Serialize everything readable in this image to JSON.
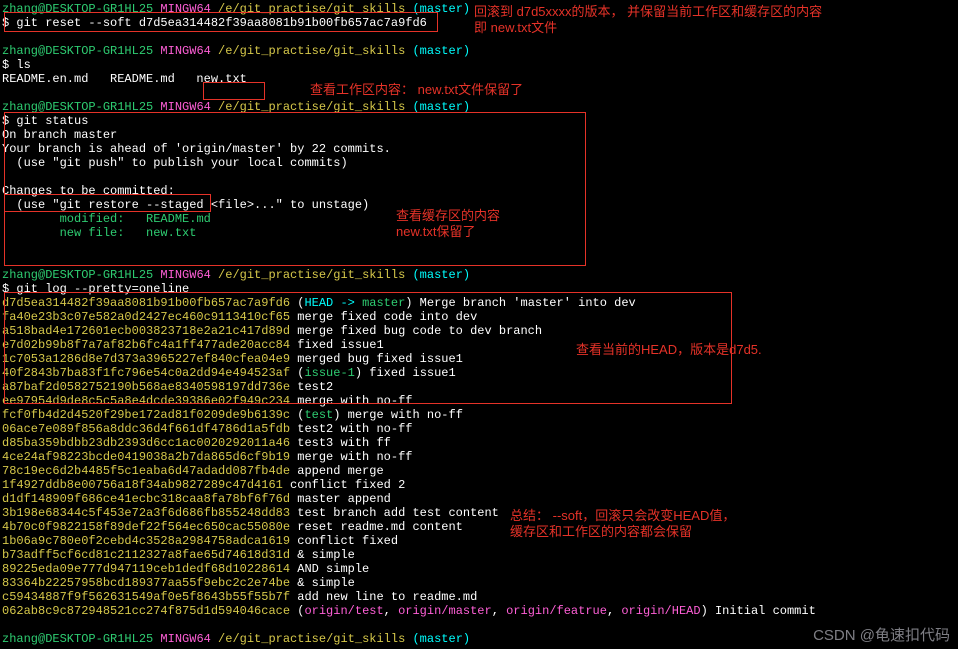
{
  "prompt": {
    "user": "zhang@DESKTOP-GR1HL25",
    "shell": " MINGW64 ",
    "path": "/e/git_practise/git_skills",
    "branch": " (master)"
  },
  "cmds": {
    "reset": "git reset --soft d7d5ea314482f39aa8081b91b00fb657ac7a9fd6",
    "ls": "ls",
    "status": "git status",
    "log": "git log --pretty=oneline"
  },
  "ls_out": "README.en.md   README.md   new.txt",
  "status": {
    "l1": "On branch master",
    "l2": "Your branch is ahead of 'origin/master' by 22 commits.",
    "l3": "  (use \"git push\" to publish your local commits)",
    "l4": "Changes to be committed:",
    "l5": "  (use \"git restore --staged <file>...\" to unstage)",
    "modlabel": "        modified:   ",
    "mod": "README.md",
    "newlabel": "        new file:   ",
    "new": "new.txt"
  },
  "refs": {
    "head_arrow": "HEAD -> ",
    "master": "master",
    "issue1": "issue-1",
    "test": "test",
    "origin_test": "origin/test",
    "origin_master": "origin/master",
    "origin_featrue": "origin/featrue",
    "origin_head": "origin/HEAD"
  },
  "log": [
    {
      "h": "d7d5ea314482f39aa8081b91b00fb657ac7a9fd6",
      "head": true,
      "m": " Merge branch 'master' into dev"
    },
    {
      "h": "fa40e23b3c07e582a0d2427ec460c9113410cf65",
      "m": " merge fixed code into dev"
    },
    {
      "h": "a518bad4e172601ecb003823718e2a21c417d89d",
      "m": " merge fixed bug code to dev branch"
    },
    {
      "h": "e7d02b99b8f7a7af82b6fc4a1ff477ade20acc84",
      "m": " fixed issue1"
    },
    {
      "h": "1c7053a1286d8e7d373a3965227ef840cfea04e9",
      "m": " merged bug fixed issue1"
    },
    {
      "h": "40f2843b7ba83f1fc796e54c0a2dd94e494523af",
      "issue": true,
      "m": " fixed issue1"
    },
    {
      "h": "a87baf2d0582752190b568ae8340598197dd736e",
      "m": " test2"
    },
    {
      "h": "ee97954d9de8c5c5a8e4dcde39386e02f949c234",
      "m": " merge with no-ff"
    },
    {
      "h": "fcf0fb4d2d4520f29be172ad81f0209de9b6139c",
      "test": true,
      "m": " merge with no-ff"
    },
    {
      "h": "06ace7e089f856a8ddc36d4f661df4786d1a5fdb",
      "m": " test2 with no-ff"
    },
    {
      "h": "d85ba359bdbb23db2393d6cc1ac0020292011a46",
      "m": " test3 with ff"
    },
    {
      "h": "4ce24af98223bcde0419038a2b7da865d6cf9b19",
      "m": " merge with no-ff"
    },
    {
      "h": "78c19ec6d2b4485f5c1eaba6d47adadd087fb4de",
      "m": " append merge"
    },
    {
      "h": "1f4927ddb8e00756a18f34ab9827289c47d4161",
      "m": " conflict fixed 2"
    },
    {
      "h": "d1df148909f686ce41ecbc318caa8fa78bf6f76d",
      "m": " master append"
    },
    {
      "h": "3b198e68344c5f453e72a3f6d686fb855248dd83",
      "m": " test branch add test content"
    },
    {
      "h": "4b70c0f9822158f89def22f564ec650cac55080e",
      "m": " reset readme.md content"
    },
    {
      "h": "1b06a9c780e0f2cebd4c3528a2984758adca1619",
      "m": " conflict fixed"
    },
    {
      "h": "b73adff5cf6cd81c2112327a8fae65d74618d31d",
      "m": " & simple"
    },
    {
      "h": "89225eda09e777d947119ceb1dedf68d10228614",
      "m": " AND simple"
    },
    {
      "h": "83364b22257958bcd189377aa55f9ebc2c2e74be",
      "m": " & simple"
    },
    {
      "h": "c59434887f9f562631549af0e5f8643b55f55b7f",
      "m": " add new line to readme.md"
    }
  ],
  "initial": {
    "h": "062ab8c9c872948521cc274f875d1d594046cace",
    "m": " Initial commit"
  },
  "annot": {
    "a1": "回滚到 d7d5xxxx的版本，  并保留当前工作区和缓存区的内容\n即 new.txt文件",
    "a2": "查看工作区内容：  new.txt文件保留了",
    "a3": "查看缓存区的内容\nnew.txt保留了",
    "a4": "查看当前的HEAD，版本是d7d5.",
    "a5": "总结：  --soft，回滚只会改变HEAD值，\n缓存区和工作区的内容都会保留"
  },
  "watermark": "CSDN @龟速扣代码",
  "sep": ", ",
  "paren_open": " (",
  "paren_close": ")",
  "dollar": "$ "
}
